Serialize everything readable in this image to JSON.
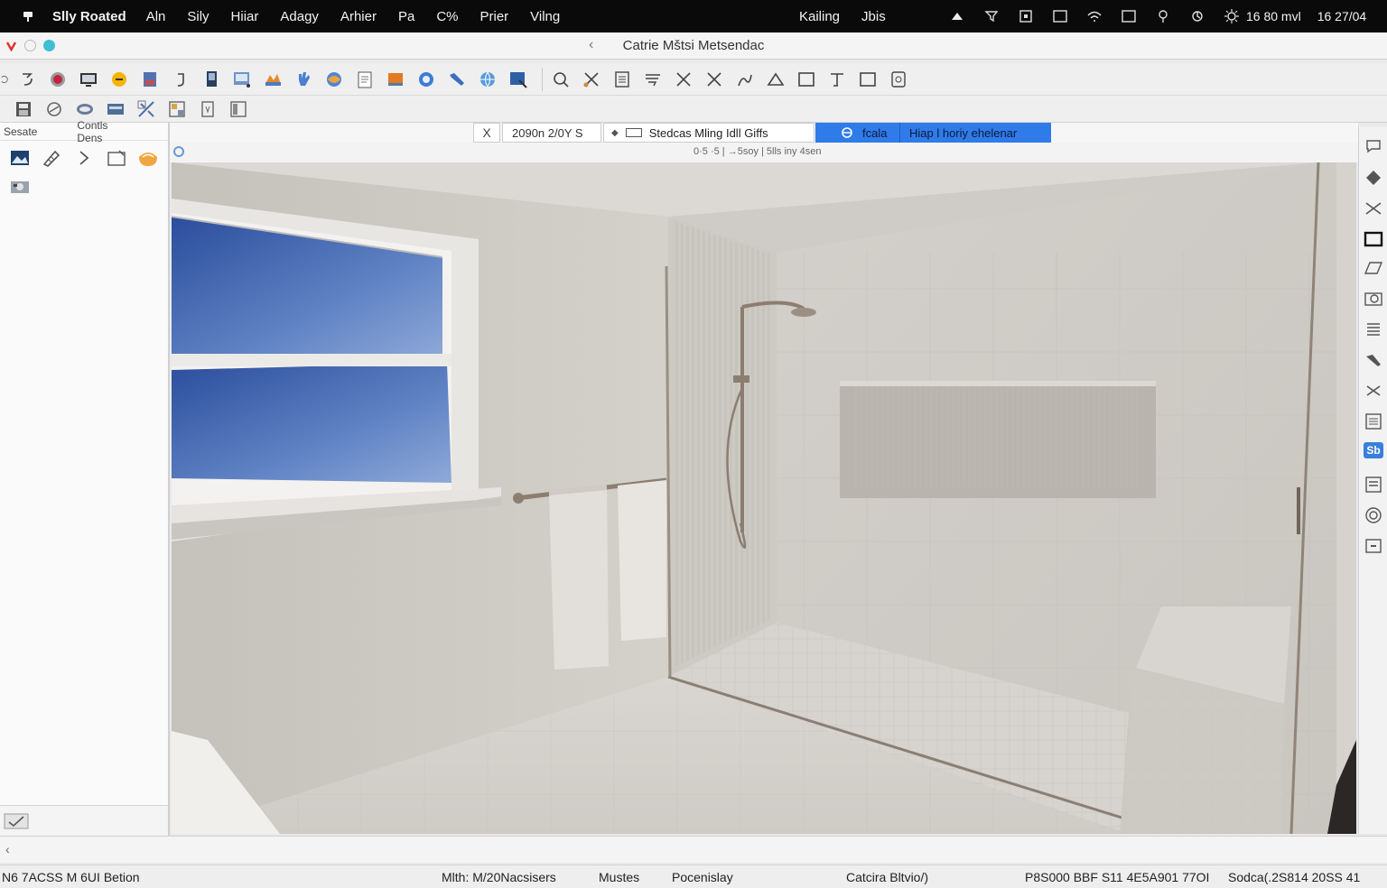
{
  "menubar": {
    "app_name": "Slly Roated",
    "items": [
      "Aln",
      "Sily",
      "Hiiar",
      "Adagy",
      "Arhier",
      "Pa",
      "C%",
      "Prier",
      "Vilng"
    ],
    "right_items": [
      "Kailing",
      "Jbis"
    ],
    "status_icons": [
      "cloud-icon",
      "funnel-icon",
      "box-icon",
      "square-icon",
      "wifi-icon",
      "window-icon",
      "location-icon",
      "sync-icon",
      "settings-icon"
    ],
    "clock_left": "16 80 mvl",
    "clock_right": "16 27/04"
  },
  "titlebar": {
    "title": "Catrie Mštsi Metsendac",
    "traffic_colors": [
      "#e0312c",
      "#e6e6e6",
      "#3fbfd4"
    ]
  },
  "toolbar": {
    "row1_icons": [
      "undo-icon",
      "record-icon",
      "monitor-icon",
      "sun-icon",
      "cube-icon",
      "redo-icon",
      "document-icon",
      "photo-icon",
      "paint-icon",
      "hand-icon",
      "color-icon",
      "page-icon",
      "palette-icon",
      "refresh-icon",
      "wrench-icon",
      "globe-icon",
      "export-icon",
      "zoom-icon",
      "scissors-icon",
      "list-icon",
      "text-icon",
      "close-icon",
      "cross-icon",
      "curve-icon",
      "triangle-icon",
      "rectangle-icon",
      "pen-icon",
      "frame-icon",
      "lock-icon"
    ],
    "row2_icons": [
      "save-icon",
      "hat-icon",
      "shape-icon",
      "brush-icon",
      "magic-icon",
      "grid-icon",
      "ruler-icon",
      "layout-icon"
    ]
  },
  "left_panel": {
    "header_left": "Sesate",
    "header_right": "Contls Dens",
    "tools": [
      "image-icon",
      "pencil-icon",
      "chevron-right-icon",
      "folder-icon",
      "shell-icon"
    ],
    "row2_tools": [
      "camera-icon"
    ]
  },
  "view_bar": {
    "close_label": "X",
    "field_value": "2090n 2/0Y S",
    "dropdown_label": "Stedcas Mling Idll Giffs",
    "highlight_left": "fcala",
    "highlight_right": "Hiap l horiy ehelenar"
  },
  "sub_bar": {
    "text": "0·5 ·5  | →5soy | 5lls iny 4sen"
  },
  "right_strip": {
    "tools": [
      "chat-icon",
      "diamond-icon",
      "scissors-icon",
      "frame-icon",
      "parallelogram-icon",
      "camera-icon",
      "grid-icon",
      "wrench-icon",
      "cross-icon",
      "list-icon",
      "badge-icon",
      "layers-icon",
      "orbit-icon",
      "minus-box-icon"
    ],
    "badge_text": "Sb"
  },
  "statusbar": {
    "left": "N6 7ACSS M 6UI Betion",
    "item2": "Mlth: M/20Nacsisers",
    "item3": "Mustes",
    "item4": "Pocenislay",
    "item5": "Catcira Bltvio/)",
    "item6": "P8S000 BBF S11 4E5A901 77OI",
    "item7": "Sodca(.2S814  20SS 41"
  }
}
